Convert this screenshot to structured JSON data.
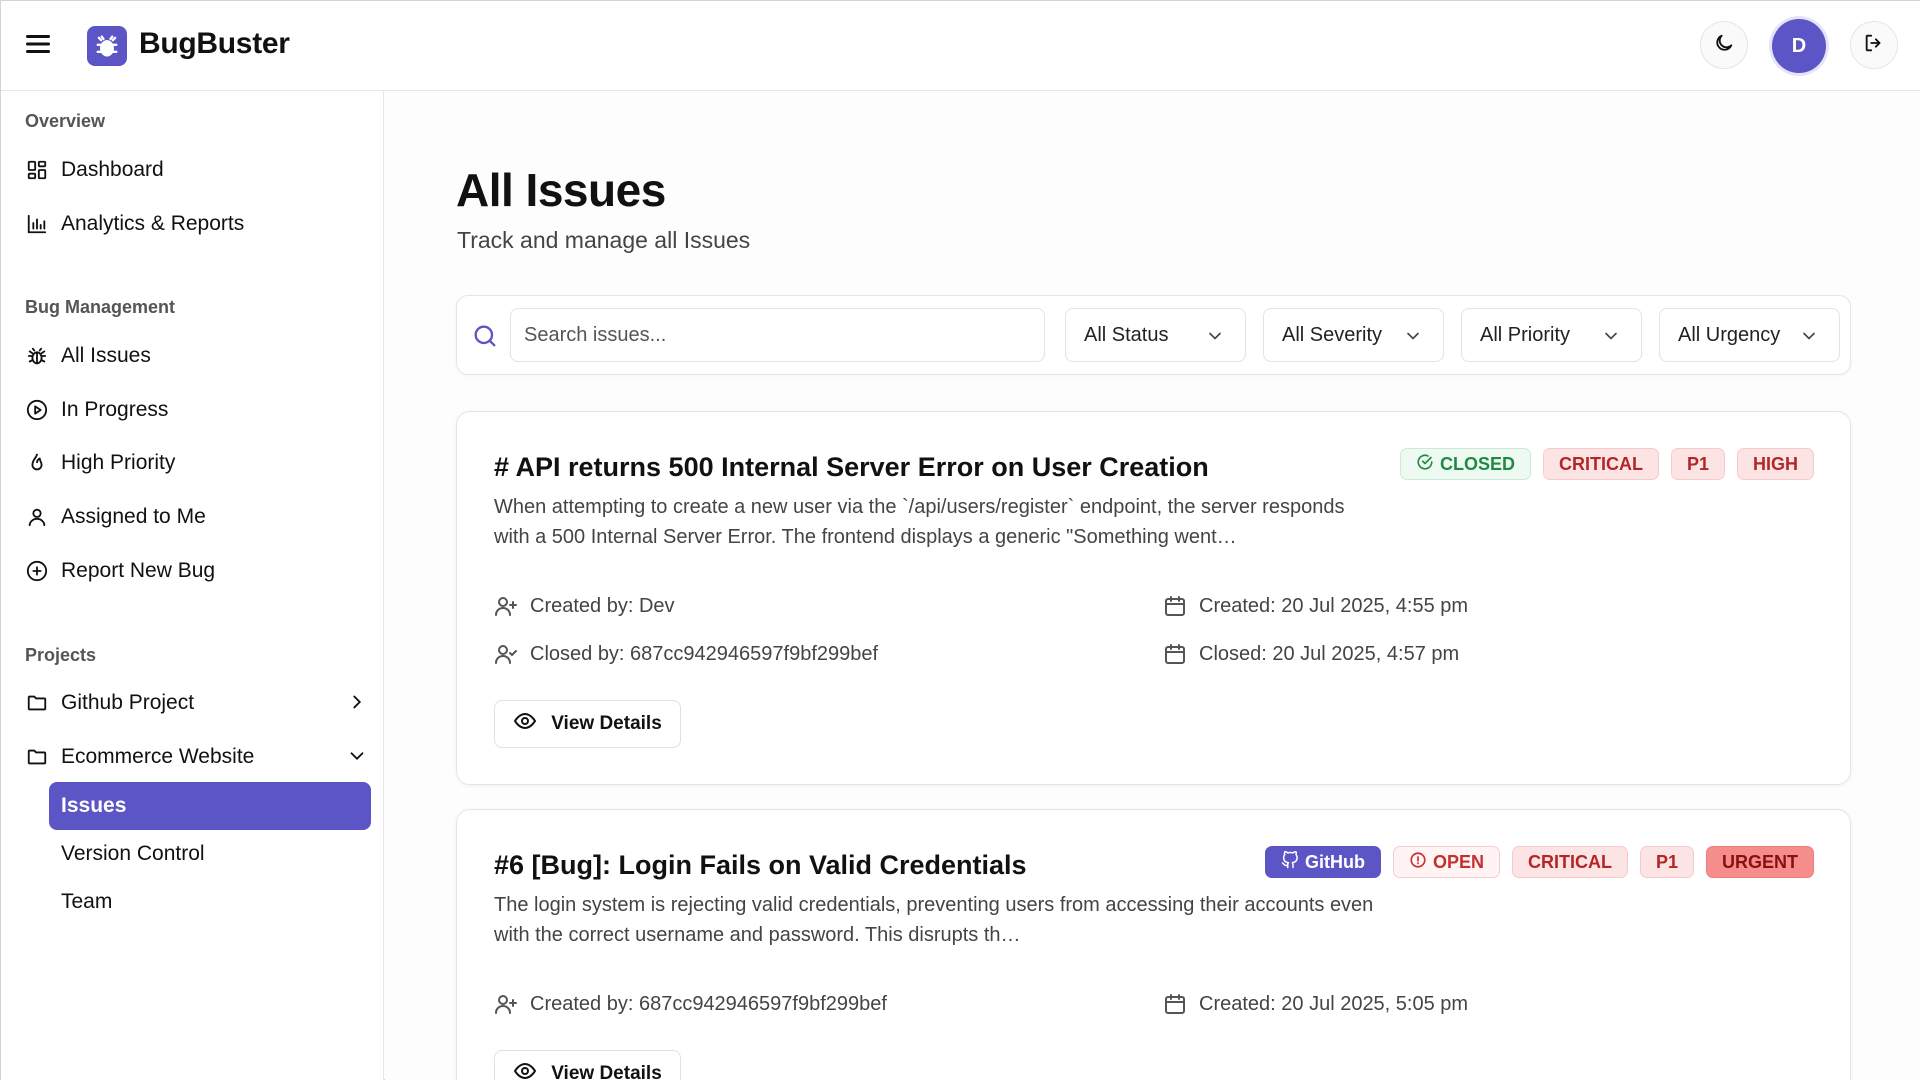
{
  "header": {
    "brand": "BugBuster",
    "avatar_initial": "D",
    "icons": [
      "menu-icon",
      "bug-logo-icon",
      "moon-icon",
      "logout-icon"
    ]
  },
  "sidebar": {
    "overview_title": "Overview",
    "overview_items": [
      {
        "label": "Dashboard",
        "icon": "dashboard-icon"
      },
      {
        "label": "Analytics & Reports",
        "icon": "bar-chart-icon"
      }
    ],
    "bug_title": "Bug Management",
    "bug_items": [
      {
        "label": "All Issues",
        "icon": "bug-icon"
      },
      {
        "label": "In Progress",
        "icon": "play-circle-icon"
      },
      {
        "label": "High Priority",
        "icon": "flame-icon"
      },
      {
        "label": "Assigned to Me",
        "icon": "user-icon"
      },
      {
        "label": "Report New Bug",
        "icon": "plus-circle-icon"
      }
    ],
    "projects_title": "Projects",
    "projects": [
      {
        "label": "Github Project",
        "icon": "folder-icon",
        "expanded": false
      },
      {
        "label": "Ecommerce Website",
        "icon": "folder-icon",
        "expanded": true
      }
    ],
    "sub_items": [
      {
        "label": "Issues",
        "active": true
      },
      {
        "label": "Version Control",
        "active": false
      },
      {
        "label": "Team",
        "active": false
      }
    ]
  },
  "main": {
    "title": "All Issues",
    "subtitle": "Track and manage all Issues",
    "search_placeholder": "Search issues...",
    "filters": [
      "All Status",
      "All Severity",
      "All Priority",
      "All Urgency"
    ],
    "view_label": "View Details",
    "issues": [
      {
        "title": "# API returns 500 Internal Server Error on User Creation",
        "description": "When attempting to create a new user via the `/api/users/register` endpoint, the server responds with a 500 Internal Server Error. The frontend displays a generic \"Something went…",
        "badges": [
          "CLOSED",
          "CRITICAL",
          "P1",
          "HIGH"
        ],
        "created_by": "Created by: Dev",
        "closed_by": "Closed by: 687cc942946597f9bf299bef",
        "created": "Created: 20 Jul 2025, 4:55 pm",
        "closed": "Closed: 20 Jul 2025, 4:57 pm"
      },
      {
        "title": "#6 [Bug]: Login Fails on Valid Credentials",
        "description": "The login system is rejecting valid credentials, preventing users from accessing their accounts even with the correct username and password. This disrupts th…",
        "badges": [
          "GitHub",
          "OPEN",
          "CRITICAL",
          "P1",
          "URGENT"
        ],
        "created_by": "Created by: 687cc942946597f9bf299bef",
        "created": "Created: 20 Jul 2025, 5:05 pm"
      }
    ]
  },
  "colors": {
    "accent": "#5b55c6",
    "closed_green": "#1f8a44",
    "critical_red": "#b32626",
    "urgent_bg": "#f58d8d"
  }
}
